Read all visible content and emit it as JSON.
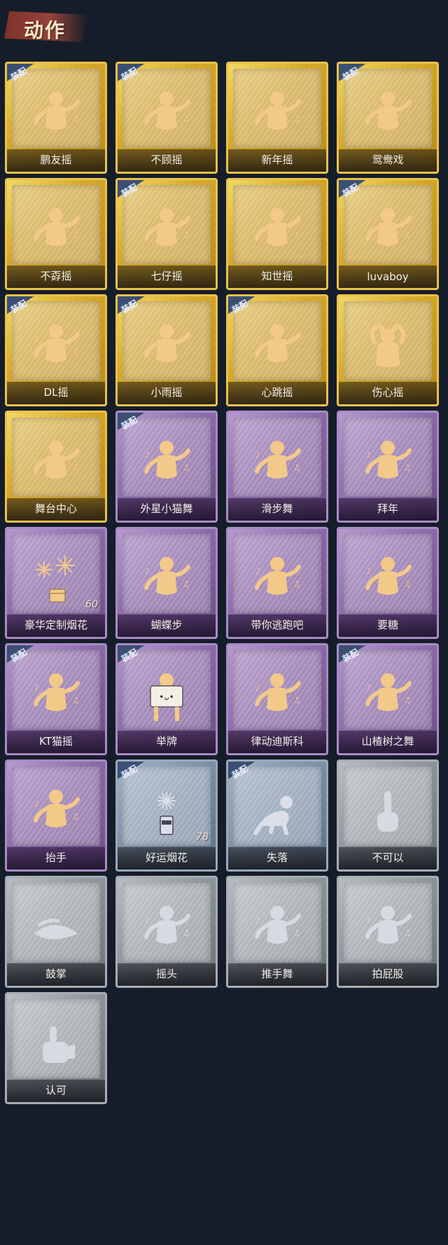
{
  "header": {
    "title": "动作"
  },
  "badge_label": "装配",
  "colors": {
    "gold": "#d4a82a",
    "purple": "#8a6aa8",
    "silver": "#8f949c",
    "bluegray": "#7f8fa6",
    "badge": "#3b4f73",
    "background": "#161d2a"
  },
  "cards": [
    {
      "label": "鹏友摇",
      "rarity": "gold",
      "equipped": true,
      "icon": "pose-icon"
    },
    {
      "label": "不顾摇",
      "rarity": "gold",
      "equipped": true,
      "icon": "pose-icon"
    },
    {
      "label": "新年摇",
      "rarity": "gold",
      "equipped": false,
      "icon": "pose-icon"
    },
    {
      "label": "鸳鸯戏",
      "rarity": "gold",
      "equipped": true,
      "icon": "pose-icon"
    },
    {
      "label": "不孬摇",
      "rarity": "gold",
      "equipped": false,
      "icon": "pose-icon"
    },
    {
      "label": "七仔摇",
      "rarity": "gold",
      "equipped": true,
      "icon": "pose-icon"
    },
    {
      "label": "知世摇",
      "rarity": "gold",
      "equipped": false,
      "icon": "pose-icon"
    },
    {
      "label": "luvaboy",
      "rarity": "gold",
      "equipped": true,
      "icon": "pose-icon"
    },
    {
      "label": "DL摇",
      "rarity": "gold",
      "equipped": true,
      "icon": "pose-icon"
    },
    {
      "label": "小雨摇",
      "rarity": "gold",
      "equipped": true,
      "icon": "pose-icon"
    },
    {
      "label": "心跳摇",
      "rarity": "gold",
      "equipped": true,
      "icon": "pose-icon"
    },
    {
      "label": "伤心摇",
      "rarity": "gold",
      "equipped": false,
      "icon": "heart-pose-icon"
    },
    {
      "label": "舞台中心",
      "rarity": "gold",
      "equipped": false,
      "icon": "pose-icon"
    },
    {
      "label": "外星小猫舞",
      "rarity": "purple",
      "equipped": true,
      "icon": "pose-icon"
    },
    {
      "label": "滑步舞",
      "rarity": "purple",
      "equipped": false,
      "icon": "pose-icon"
    },
    {
      "label": "拜年",
      "rarity": "purple",
      "equipped": false,
      "icon": "pose-icon"
    },
    {
      "label": "豪华定制烟花",
      "rarity": "purple",
      "equipped": false,
      "icon": "fireworks-box-icon",
      "quantity": "60"
    },
    {
      "label": "蝴蝶步",
      "rarity": "purple",
      "equipped": false,
      "icon": "pose-icon"
    },
    {
      "label": "带你逃跑吧",
      "rarity": "purple",
      "equipped": false,
      "icon": "pose-icon"
    },
    {
      "label": "要糖",
      "rarity": "purple",
      "equipped": false,
      "icon": "pose-icon"
    },
    {
      "label": "KT猫摇",
      "rarity": "purple",
      "equipped": true,
      "icon": "pose-icon"
    },
    {
      "label": "举牌",
      "rarity": "purple",
      "equipped": true,
      "icon": "sign-icon"
    },
    {
      "label": "律动迪斯科",
      "rarity": "purple",
      "equipped": false,
      "icon": "pose-icon"
    },
    {
      "label": "山楂树之舞",
      "rarity": "purple",
      "equipped": true,
      "icon": "pose-icon"
    },
    {
      "label": "抬手",
      "rarity": "purple",
      "equipped": false,
      "icon": "pose-icon"
    },
    {
      "label": "好运烟花",
      "rarity": "bluegray",
      "equipped": true,
      "icon": "firework-can-icon",
      "quantity": "78"
    },
    {
      "label": "失落",
      "rarity": "bluegray",
      "equipped": true,
      "icon": "crawl-pose-icon"
    },
    {
      "label": "不可以",
      "rarity": "silver",
      "equipped": false,
      "icon": "finger-icon"
    },
    {
      "label": "鼓掌",
      "rarity": "silver",
      "equipped": false,
      "icon": "clap-icon"
    },
    {
      "label": "摇头",
      "rarity": "silver",
      "equipped": false,
      "icon": "pose-icon"
    },
    {
      "label": "推手舞",
      "rarity": "silver",
      "equipped": false,
      "icon": "pose-icon"
    },
    {
      "label": "拍屁股",
      "rarity": "silver",
      "equipped": false,
      "icon": "pose-icon"
    },
    {
      "label": "认可",
      "rarity": "silver",
      "equipped": false,
      "icon": "thumbs-up-icon"
    }
  ]
}
